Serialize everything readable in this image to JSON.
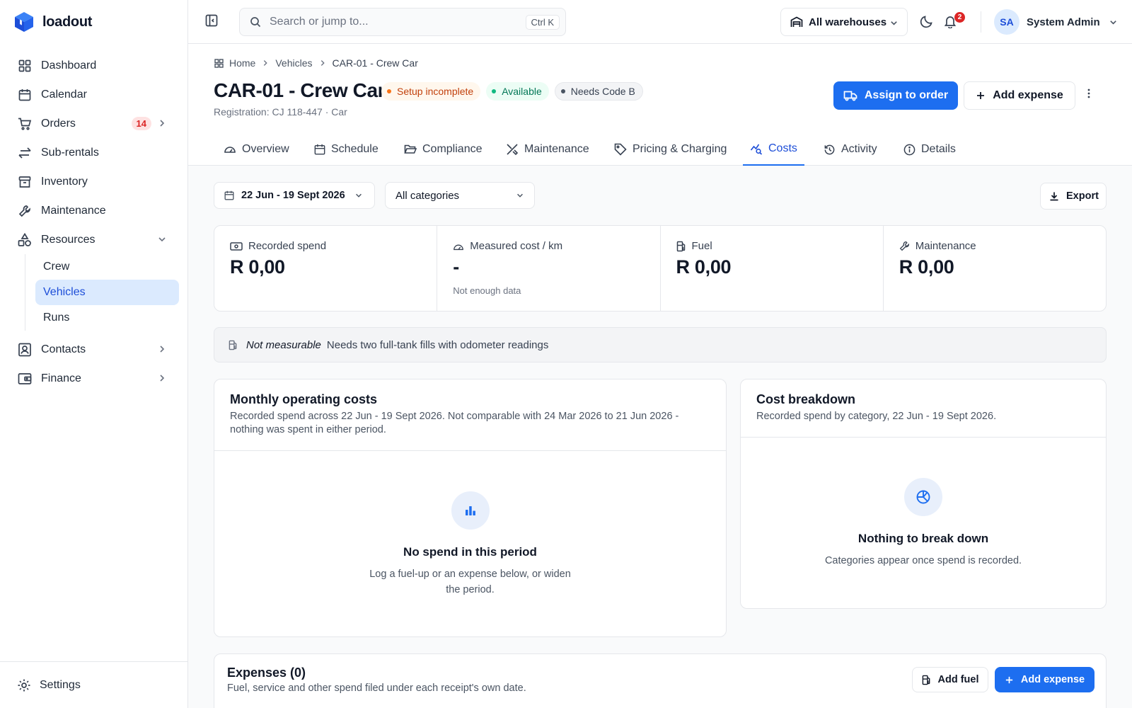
{
  "brand": {
    "name": "loadout"
  },
  "sidebar": {
    "items": [
      {
        "label": "Dashboard"
      },
      {
        "label": "Calendar"
      },
      {
        "label": "Orders",
        "badge": "14"
      },
      {
        "label": "Sub-rentals"
      },
      {
        "label": "Inventory"
      },
      {
        "label": "Maintenance"
      },
      {
        "label": "Resources"
      },
      {
        "label": "Contacts"
      },
      {
        "label": "Finance"
      }
    ],
    "resources_children": [
      {
        "label": "Crew"
      },
      {
        "label": "Vehicles"
      },
      {
        "label": "Runs"
      }
    ],
    "settings_label": "Settings"
  },
  "topbar": {
    "search_placeholder": "Search or jump to...",
    "search_shortcut": "Ctrl K",
    "warehouse": "All warehouses",
    "notification_count": "2",
    "user_initials": "SA",
    "user_name": "System Admin"
  },
  "breadcrumb": [
    "Home",
    "Vehicles",
    "CAR-01 - Crew Car"
  ],
  "page": {
    "title": "CAR-01 - Crew Car",
    "badges": [
      "Setup incomplete",
      "Available",
      "Needs Code B"
    ],
    "subtitle": "Registration: CJ 118-447 · Car",
    "assign_label": "Assign to order",
    "add_expense_label": "Add expense"
  },
  "tabs": [
    "Overview",
    "Schedule",
    "Compliance",
    "Maintenance",
    "Pricing & Charging",
    "Costs",
    "Activity",
    "Details"
  ],
  "active_tab": "Costs",
  "filters": {
    "date_range": "22 Jun - 19 Sept 2026",
    "category": "All categories",
    "export_label": "Export"
  },
  "stats": [
    {
      "label": "Recorded spend",
      "value": "R 0,00",
      "note": ""
    },
    {
      "label": "Measured cost / km",
      "value": "-",
      "note": "Not enough data"
    },
    {
      "label": "Fuel",
      "value": "R 0,00",
      "note": ""
    },
    {
      "label": "Maintenance",
      "value": "R 0,00",
      "note": ""
    }
  ],
  "notice": {
    "strong": "Not measurable",
    "text": "Needs two full-tank fills with odometer readings"
  },
  "monthly_card": {
    "title": "Monthly operating costs",
    "description": "Recorded spend across 22 Jun - 19 Sept 2026. Not comparable with 24 Mar 2026 to 21 Jun 2026 - nothing was spent in either period.",
    "empty_title": "No spend in this period",
    "empty_text_line1": "Log a fuel-up or an expense below, or widen",
    "empty_text_line2": "the period."
  },
  "breakdown_card": {
    "title": "Cost breakdown",
    "description": "Recorded spend by category, 22 Jun - 19 Sept 2026.",
    "empty_title": "Nothing to break down",
    "empty_text": "Categories appear once spend is recorded."
  },
  "expenses_card": {
    "title": "Expenses (0)",
    "description": "Fuel, service and other spend filed under each receipt's own date.",
    "add_fuel_label": "Add fuel",
    "add_expense_label": "Add expense"
  },
  "colors": {
    "primary": "#1d6ef0",
    "active_nav_bg": "#dbeafe",
    "warn": "#c2410c",
    "success": "#047857",
    "danger": "#dc2626"
  }
}
